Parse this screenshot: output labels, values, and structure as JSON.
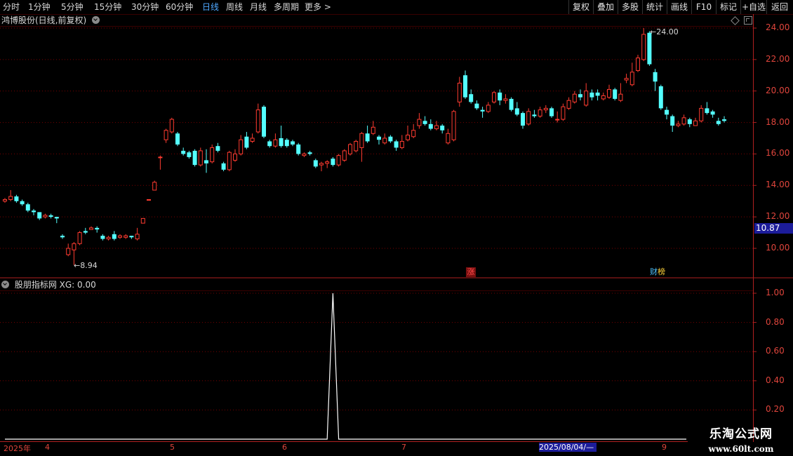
{
  "toolbar": {
    "periods": [
      "分时",
      "1分钟",
      "5分钟",
      "15分钟",
      "30分钟",
      "60分钟",
      "日线",
      "周线",
      "月线",
      "多周期",
      "更多 >"
    ],
    "active_period": "日线",
    "right_buttons": [
      "复权",
      "叠加",
      "多股",
      "统计",
      "画线",
      "F10",
      "标记",
      "+自选",
      "返回"
    ]
  },
  "main_panel": {
    "title": "鸿博股份(日线,前复权)",
    "current_price": "10.87",
    "high_label": "24.00",
    "low_label": "8.94",
    "markers": {
      "zhang": "涨",
      "cai_a": "财",
      "cai_b": "榜"
    }
  },
  "indicator_panel": {
    "title": "股朋指标网  XG: 0.00"
  },
  "x_axis": {
    "year_label": "2025年",
    "month_labels": [
      "4",
      "5",
      "6",
      "7",
      "9"
    ],
    "cursor_date": "2025/08/04/—"
  },
  "watermark": {
    "text": "乐淘公式网",
    "url": "www.60lt.com"
  },
  "colors": {
    "up": "#ff3b30",
    "down": "#54ffff",
    "grid": "#7a0000",
    "axis_text": "#e0453c",
    "xg_line": "#ffffff"
  },
  "chart_data": [
    {
      "type": "candlestick",
      "title": "鸿博股份(日线,前复权)",
      "y_ticks": [
        "24.00",
        "22.00",
        "20.00",
        "18.00",
        "16.00",
        "14.00",
        "12.00",
        "10.00"
      ],
      "ylim": [
        8.0,
        24.5
      ],
      "candles": [
        [
          13.0,
          13.1,
          13.2,
          12.9
        ],
        [
          13.1,
          13.3,
          13.7,
          13.0
        ],
        [
          13.3,
          13.0,
          13.4,
          12.9
        ],
        [
          13.0,
          12.8,
          13.1,
          12.7
        ],
        [
          12.8,
          12.4,
          12.9,
          12.3
        ],
        [
          12.4,
          12.3,
          12.5,
          12.1
        ],
        [
          12.3,
          11.9,
          12.3,
          11.8
        ],
        [
          12.0,
          12.1,
          12.2,
          11.9
        ],
        [
          12.1,
          12.0,
          12.2,
          11.9
        ],
        [
          12.0,
          11.9,
          12.0,
          11.6
        ],
        [
          10.8,
          10.7,
          10.9,
          10.6
        ],
        [
          9.6,
          10.0,
          10.3,
          9.5
        ],
        [
          9.9,
          10.3,
          10.4,
          8.94
        ],
        [
          10.3,
          11.0,
          11.1,
          10.2
        ],
        [
          11.1,
          11.0,
          11.3,
          10.9
        ],
        [
          11.2,
          11.3,
          11.4,
          11.2
        ],
        [
          11.3,
          11.2,
          11.4,
          11.0
        ],
        [
          10.8,
          10.6,
          10.9,
          10.5
        ],
        [
          10.6,
          10.7,
          10.8,
          10.5
        ],
        [
          10.9,
          10.6,
          11.1,
          10.5
        ],
        [
          10.7,
          10.8,
          10.9,
          10.6
        ],
        [
          10.7,
          10.8,
          10.9,
          10.6
        ],
        [
          10.8,
          10.7,
          10.8,
          10.6
        ],
        [
          10.6,
          10.9,
          11.3,
          10.5
        ],
        [
          11.6,
          11.9,
          11.9,
          11.6
        ],
        [
          13.1,
          13.1,
          13.1,
          13.1
        ],
        [
          13.7,
          14.2,
          14.3,
          13.7
        ],
        [
          15.8,
          15.8,
          15.9,
          15.0
        ],
        [
          16.9,
          17.5,
          17.6,
          16.7
        ],
        [
          17.4,
          18.2,
          18.3,
          17.3
        ],
        [
          17.3,
          16.6,
          17.4,
          16.5
        ],
        [
          16.2,
          16.0,
          16.4,
          15.9
        ],
        [
          16.1,
          15.8,
          16.2,
          15.7
        ],
        [
          16.2,
          15.3,
          16.3,
          15.2
        ],
        [
          15.3,
          16.2,
          16.4,
          15.2
        ],
        [
          15.6,
          15.4,
          16.3,
          14.8
        ],
        [
          15.5,
          16.4,
          16.6,
          15.4
        ],
        [
          16.5,
          16.2,
          16.7,
          16.1
        ],
        [
          15.4,
          15.0,
          15.5,
          14.9
        ],
        [
          15.0,
          16.1,
          16.2,
          14.9
        ],
        [
          15.6,
          16.0,
          16.3,
          15.5
        ],
        [
          16.0,
          16.9,
          17.2,
          15.9
        ],
        [
          17.1,
          16.4,
          17.4,
          16.3
        ],
        [
          16.8,
          17.0,
          17.3,
          16.7
        ],
        [
          17.4,
          18.8,
          19.2,
          17.3
        ],
        [
          19.0,
          17.1,
          19.1,
          17.0
        ],
        [
          16.8,
          16.5,
          16.9,
          16.4
        ],
        [
          16.5,
          16.9,
          17.3,
          16.4
        ],
        [
          17.0,
          16.5,
          17.8,
          16.4
        ],
        [
          16.9,
          16.5,
          17.0,
          16.4
        ],
        [
          16.8,
          16.6,
          16.9,
          16.5
        ],
        [
          16.6,
          16.0,
          16.7,
          15.9
        ],
        [
          15.9,
          16.0,
          16.1,
          15.8
        ],
        [
          16.1,
          16.0,
          16.2,
          15.9
        ],
        [
          15.6,
          15.2,
          15.7,
          15.1
        ],
        [
          15.3,
          15.4,
          15.5,
          14.9
        ],
        [
          15.4,
          15.5,
          15.6,
          15.1
        ],
        [
          15.7,
          15.3,
          15.8,
          15.2
        ],
        [
          15.3,
          15.9,
          16.0,
          15.2
        ],
        [
          15.6,
          16.2,
          16.3,
          15.5
        ],
        [
          16.0,
          16.6,
          16.7,
          15.9
        ],
        [
          16.2,
          16.8,
          16.9,
          16.1
        ],
        [
          16.4,
          17.3,
          17.4,
          15.5
        ],
        [
          17.3,
          16.8,
          17.8,
          16.7
        ],
        [
          17.3,
          17.7,
          18.1,
          17.2
        ],
        [
          17.1,
          16.9,
          17.2,
          16.6
        ],
        [
          16.7,
          17.0,
          17.3,
          16.6
        ],
        [
          17.1,
          16.8,
          17.2,
          16.7
        ],
        [
          16.8,
          16.4,
          16.9,
          16.2
        ],
        [
          16.4,
          16.8,
          17.2,
          16.3
        ],
        [
          16.9,
          17.2,
          17.8,
          16.8
        ],
        [
          17.1,
          17.5,
          17.9,
          17.0
        ],
        [
          17.8,
          18.2,
          18.6,
          17.6
        ],
        [
          18.1,
          17.9,
          18.4,
          17.8
        ],
        [
          17.9,
          17.6,
          18.2,
          17.5
        ],
        [
          17.6,
          17.8,
          18.1,
          17.5
        ],
        [
          17.8,
          17.5,
          17.9,
          17.3
        ],
        [
          16.7,
          17.3,
          17.6,
          16.6
        ],
        [
          16.9,
          18.7,
          18.8,
          16.8
        ],
        [
          19.3,
          20.5,
          20.9,
          19.0
        ],
        [
          21.0,
          19.6,
          21.3,
          19.5
        ],
        [
          19.8,
          19.3,
          20.1,
          19.2
        ],
        [
          19.2,
          18.9,
          19.4,
          18.8
        ],
        [
          18.8,
          18.7,
          19.0,
          18.3
        ],
        [
          18.7,
          19.1,
          19.3,
          18.6
        ],
        [
          19.3,
          19.9,
          20.0,
          19.2
        ],
        [
          19.9,
          19.4,
          20.1,
          19.1
        ],
        [
          19.4,
          19.5,
          19.8,
          19.2
        ],
        [
          19.5,
          18.8,
          19.6,
          18.7
        ],
        [
          18.9,
          18.5,
          19.3,
          18.4
        ],
        [
          18.6,
          17.8,
          18.7,
          17.6
        ],
        [
          17.9,
          18.7,
          18.9,
          17.8
        ],
        [
          18.5,
          18.4,
          18.8,
          18.3
        ],
        [
          18.4,
          18.8,
          19.0,
          18.3
        ],
        [
          18.8,
          18.9,
          19.1,
          18.6
        ],
        [
          18.9,
          18.4,
          19.0,
          18.3
        ],
        [
          18.2,
          18.2,
          18.7,
          18.0
        ],
        [
          18.2,
          19.0,
          19.2,
          18.1
        ],
        [
          18.9,
          19.4,
          19.6,
          18.8
        ],
        [
          19.3,
          19.8,
          20.0,
          19.2
        ],
        [
          19.8,
          19.6,
          20.1,
          19.4
        ],
        [
          19.1,
          20.0,
          20.5,
          19.0
        ],
        [
          19.9,
          19.6,
          20.1,
          19.4
        ],
        [
          19.9,
          19.7,
          20.1,
          19.4
        ],
        [
          19.5,
          19.7,
          19.9,
          19.4
        ],
        [
          19.6,
          20.1,
          20.4,
          19.5
        ],
        [
          20.1,
          19.5,
          20.2,
          19.4
        ],
        [
          19.4,
          19.8,
          20.5,
          19.3
        ],
        [
          20.7,
          20.8,
          21.1,
          20.5
        ],
        [
          20.4,
          21.2,
          21.8,
          20.3
        ],
        [
          21.3,
          22.1,
          22.3,
          21.2
        ],
        [
          22.0,
          23.6,
          24.0,
          21.9
        ],
        [
          23.7,
          21.7,
          23.8,
          21.6
        ],
        [
          21.2,
          20.6,
          21.4,
          20.0
        ],
        [
          20.3,
          18.9,
          20.4,
          18.8
        ],
        [
          18.8,
          18.5,
          19.0,
          18.2
        ],
        [
          18.4,
          17.8,
          18.5,
          17.4
        ],
        [
          17.8,
          17.9,
          18.1,
          17.7
        ],
        [
          17.9,
          18.3,
          18.5,
          17.8
        ],
        [
          18.2,
          17.9,
          18.3,
          17.7
        ],
        [
          17.8,
          18.1,
          18.3,
          17.8
        ],
        [
          18.1,
          18.9,
          19.1,
          18.0
        ],
        [
          18.9,
          18.6,
          19.3,
          18.5
        ],
        [
          18.7,
          18.5,
          18.8,
          18.3
        ],
        [
          18.1,
          17.9,
          18.3,
          17.8
        ],
        [
          18.2,
          18.1,
          18.4,
          18.0
        ]
      ]
    },
    {
      "type": "line",
      "title": "股朋指标网  XG: 0.00",
      "y_ticks": [
        "1.00",
        "0.80",
        "0.60",
        "0.40",
        "0.20"
      ],
      "ylim": [
        0,
        1.0
      ],
      "series": [
        {
          "name": "XG",
          "x": [
            0,
            55,
            56,
            57,
            58,
            125
          ],
          "values": [
            0,
            0,
            0,
            1.0,
            0,
            0
          ]
        }
      ]
    }
  ]
}
